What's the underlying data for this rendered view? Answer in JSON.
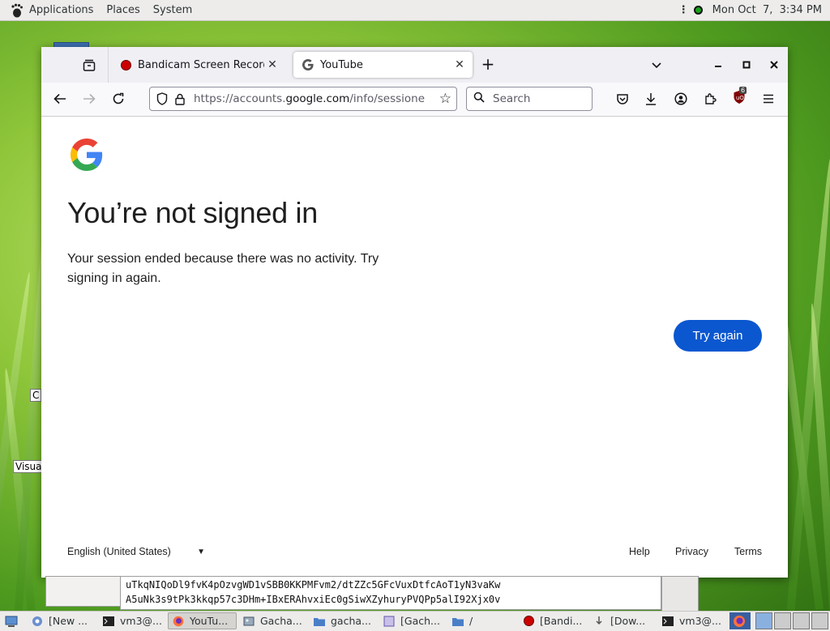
{
  "top_panel": {
    "menus": [
      "Applications",
      "Places",
      "System"
    ],
    "clock": "Mon Oct  7,  3:34 PM"
  },
  "desktop": {
    "labels": [
      "C",
      "Visua"
    ]
  },
  "browser": {
    "tabs": [
      {
        "title": "Bandicam Screen Recorder D",
        "icon": "record-icon"
      },
      {
        "title": "YouTube",
        "icon": "google-g-icon"
      }
    ],
    "url_prefix": "https://accounts.",
    "url_domain": "google.com",
    "url_suffix": "/info/sessionexpired",
    "search_placeholder": "Search",
    "ublock_badge": "6"
  },
  "page": {
    "heading": "You’re not signed in",
    "message": "Your session ended because there was no activity. Try signing in again.",
    "try_again": "Try again",
    "language": "English (United States)",
    "footer": {
      "help": "Help",
      "privacy": "Privacy",
      "terms": "Terms"
    }
  },
  "terminal": {
    "line1": "uTkqNIQoDl9fvK4pOzvgWD1vSBB0KKPMFvm2/dtZZc5GFcVuxDtfcAoT1yN3vaKw",
    "line2": "A5uNk3s9tPk3kkqp57c3DHm+IBxERAhvxiEc0gSiwXZyhuryPVQPp5alI92Xjx0v"
  },
  "taskbar": {
    "items": [
      "[New ...",
      "vm3@...",
      "YouTu...",
      "Gacha...",
      "gacha...",
      "[Gach...",
      "/",
      "[Bandi...",
      "[Dow...",
      "vm3@..."
    ]
  },
  "colors": {
    "accent": "#0b57d0",
    "heading": "#1f1f1f"
  }
}
